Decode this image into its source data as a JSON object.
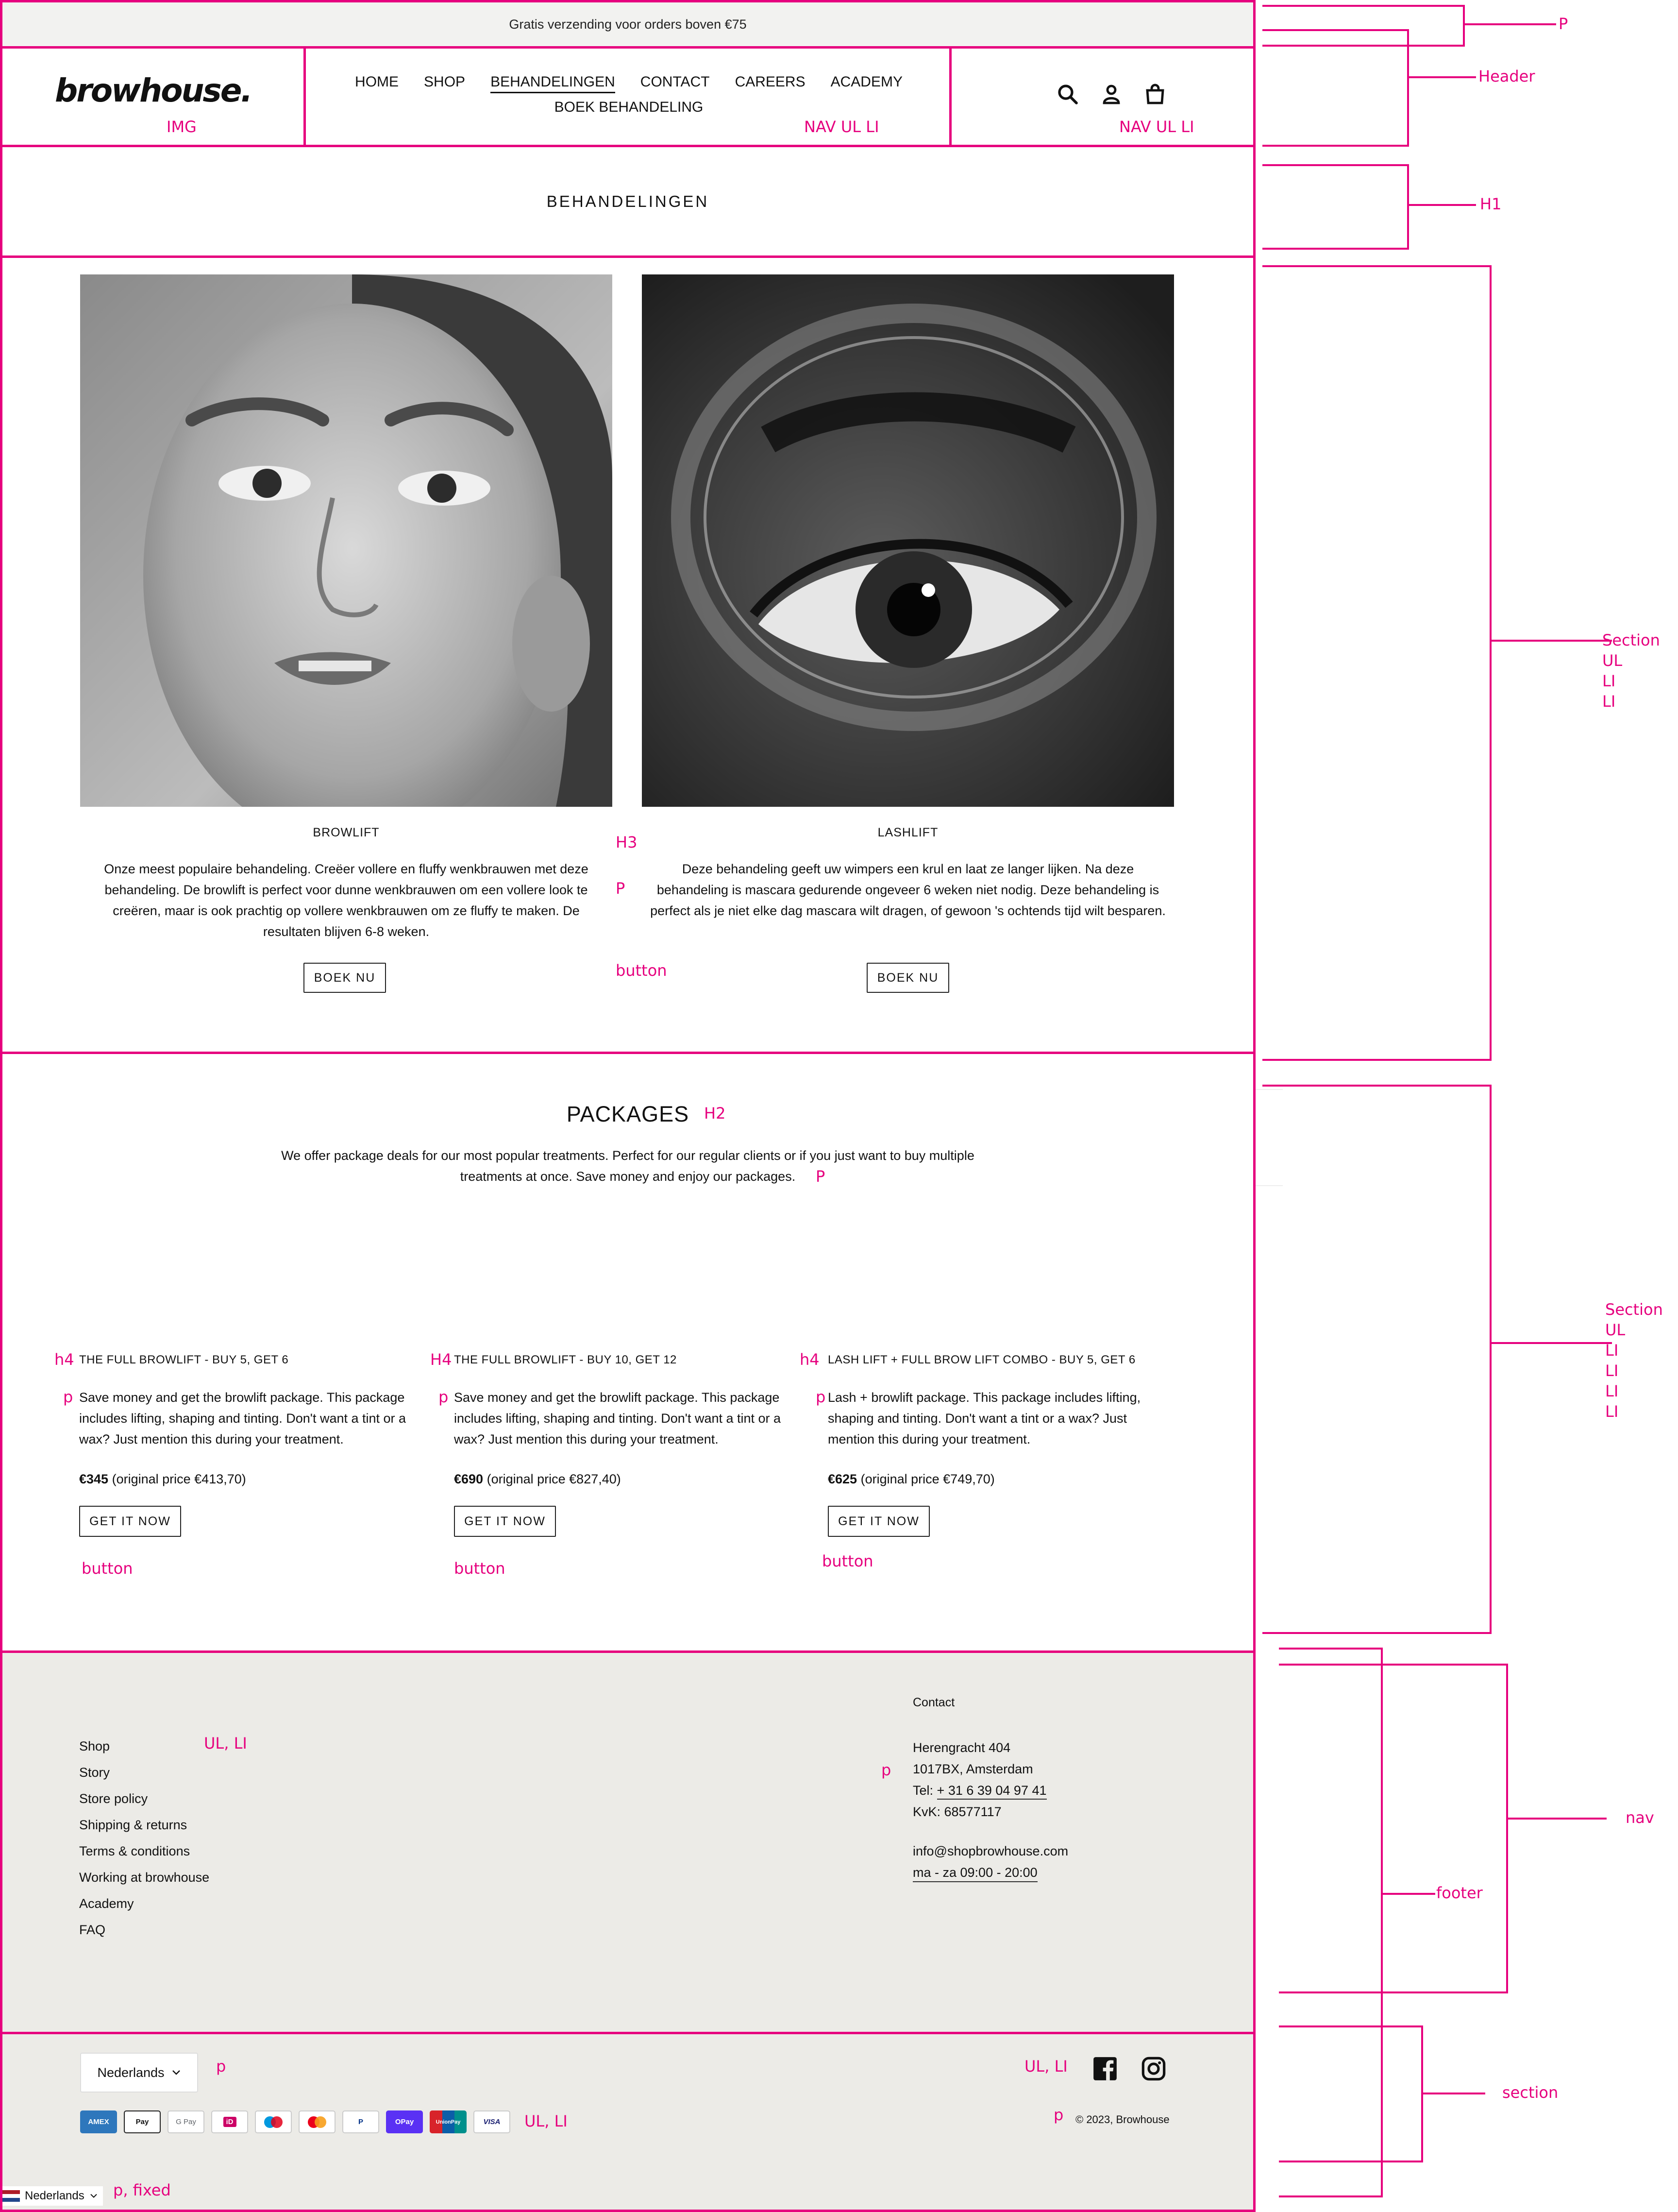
{
  "announcement": "Gratis verzending voor orders boven €75",
  "header": {
    "logo": "browhouse.",
    "nav_row1": [
      "HOME",
      "SHOP",
      "BEHANDELINGEN",
      "CONTACT",
      "CAREERS",
      "ACADEMY"
    ],
    "nav_row2": "BOEK BEHANDELING",
    "active_nav": "BEHANDELINGEN",
    "icons": [
      "search-icon",
      "account-icon",
      "cart-icon"
    ]
  },
  "page_title": "BEHANDELINGEN",
  "treatments": [
    {
      "title": "BROWLIFT",
      "description": "Onze meest populaire behandeling. Creëer vollere en fluffy wenkbrauwen met deze behandeling. De browlift is perfect voor dunne wenkbrauwen om een vollere look te creëren, maar is ook prachtig op vollere wenkbrauwen om ze fluffy te maken. De resultaten blijven 6-8 weken.",
      "button": "BOEK NU"
    },
    {
      "title": "LASHLIFT",
      "description": "Deze behandeling geeft uw wimpers een krul en laat ze langer lijken. Na deze behandeling is mascara gedurende ongeveer 6 weken niet nodig. Deze behandeling is perfect als je niet elke dag mascara wilt dragen, of gewoon 's ochtends tijd wilt besparen.",
      "button": "BOEK NU"
    }
  ],
  "packages": {
    "heading": "PACKAGES",
    "intro": "We offer package deals for our most popular treatments. Perfect for our regular clients or if you just want to buy multiple treatments at once. Save money and enjoy our packages.",
    "items": [
      {
        "title": "THE FULL BROWLIFT - BUY 5, GET 6",
        "description": "Save money and get the browlift package. This package includes lifting, shaping and tinting. Don't want a tint or a wax? Just mention this during your treatment.",
        "price": "€345",
        "original": "(original price €413,70)",
        "button": "GET IT NOW"
      },
      {
        "title": "THE FULL BROWLIFT - BUY 10, GET 12",
        "description": "Save money and get the browlift package. This package includes lifting, shaping and tinting. Don't want a tint or a wax? Just mention this during your treatment.",
        "price": "€690",
        "original": "(original price €827,40)",
        "button": "GET IT NOW"
      },
      {
        "title": "LASH LIFT + FULL BROW LIFT COMBO - BUY 5, GET 6",
        "description": "Lash + browlift package. This package includes lifting, shaping and tinting. Don't want a tint or a wax? Just mention this during your treatment.",
        "price": "€625",
        "original": "(original price €749,70)",
        "button": "GET IT NOW"
      }
    ]
  },
  "footer": {
    "links": [
      "Shop",
      "Story",
      "Store policy",
      "Shipping & returns",
      "Terms & conditions",
      "Working at browhouse",
      "Academy",
      "FAQ"
    ],
    "contact_heading": "Contact",
    "address_line1": "Herengracht 404",
    "address_line2": "1017BX, Amsterdam",
    "tel_label": "Tel:",
    "tel": "+ 31 6 39 04 97 41",
    "kvk": "KvK: 68577117",
    "email": "info@shopbrowhouse.com",
    "hours": "ma - za 09:00 - 20:00",
    "language": "Nederlands",
    "payments": [
      "AMEX",
      "Pay",
      "G Pay",
      "iD",
      "",
      "",
      "P",
      "OPay",
      "UnionPay",
      "VISA"
    ],
    "social": [
      "facebook-icon",
      "instagram-icon"
    ],
    "copyright": "© 2023, Browhouse",
    "fixed_language": "Nederlands"
  },
  "annotations": {
    "top_p": "P",
    "header": "Header",
    "h1": "H1",
    "section1": [
      "Section",
      "UL",
      "LI",
      "LI"
    ],
    "section2": [
      "Section",
      "UL",
      "LI",
      "LI",
      "LI",
      "LI"
    ],
    "nav": "nav",
    "footer": "footer",
    "section3": "section",
    "img": "IMG",
    "nav_ul_li": "NAV UL LI",
    "h3": "H3",
    "p": "P",
    "button": "button",
    "h2": "H2",
    "h4": "h4",
    "H4": "H4",
    "p_lower": "p",
    "ul_li": "UL, LI",
    "ul_li_upper": "UL, LI",
    "p_fixed": "p, fixed"
  },
  "colors": {
    "annotation": "#e6007e",
    "footer_bg": "#ecebe7",
    "announce_bg": "#f2f2f0"
  }
}
